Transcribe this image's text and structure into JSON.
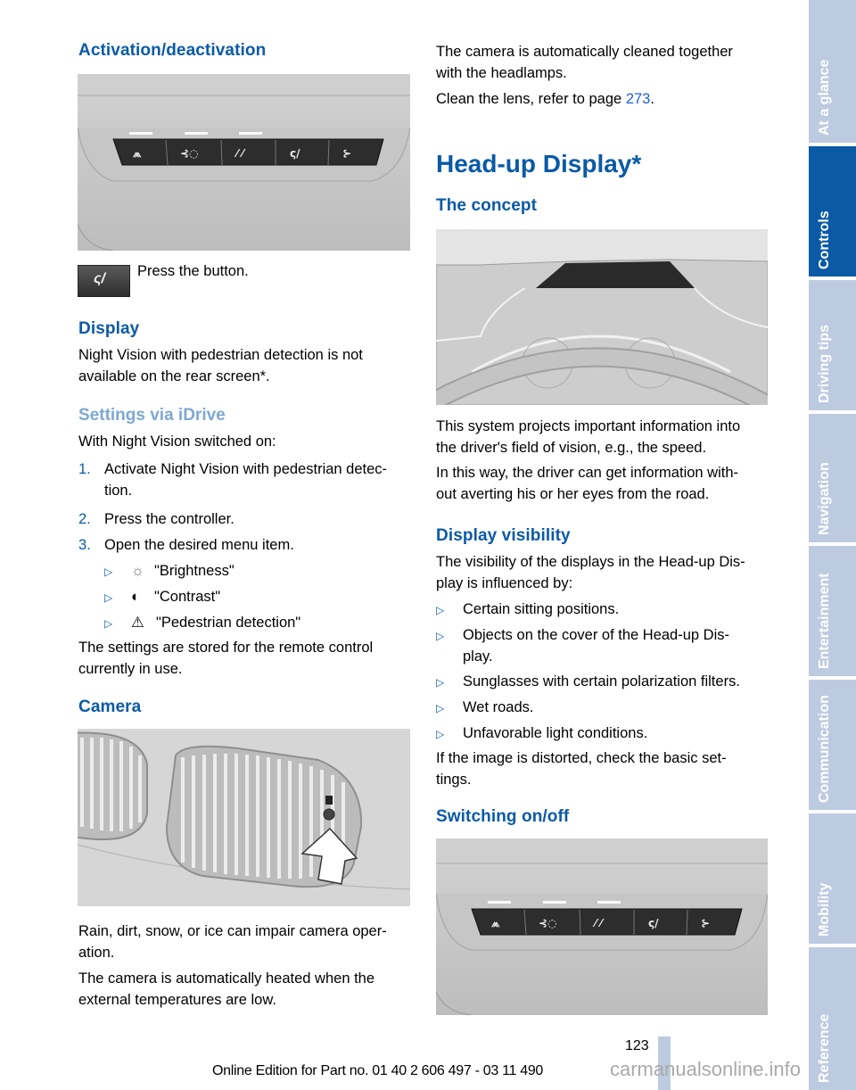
{
  "left_column": {
    "activation_heading": "Activation/deactivation",
    "press_button_text": "Press the button.",
    "display_heading": "Display",
    "display_text_line1": "Night Vision with pedestrian detection is not",
    "display_text_line2": "available on the rear screen*.",
    "settings_heading": "Settings via iDrive",
    "settings_intro": "With Night Vision switched on:",
    "steps": [
      {
        "num": "1.",
        "line1": "Activate Night Vision with pedestrian detec-",
        "line2": "tion."
      },
      {
        "num": "2.",
        "line1": "Press the controller."
      },
      {
        "num": "3.",
        "line1": "Open the desired menu item."
      }
    ],
    "menu_items": [
      {
        "icon": "brightness-icon",
        "glyph": "☼",
        "label": "\"Brightness\""
      },
      {
        "icon": "contrast-icon",
        "glyph": "◐",
        "label": "\"Contrast\""
      },
      {
        "icon": "warning-triangle-icon",
        "glyph": "⚠",
        "label": "\"Pedestrian detection\""
      }
    ],
    "bullet_glyph": "▷",
    "settings_stored_line1": "The settings are stored for the remote control",
    "settings_stored_line2": "currently in use.",
    "camera_heading": "Camera",
    "camera_text1_line1": "Rain, dirt, snow, or ice can impair camera oper-",
    "camera_text1_line2": "ation.",
    "camera_text2_line1": "The camera is automatically heated when the",
    "camera_text2_line2": "external temperatures are low."
  },
  "right_column": {
    "clean_text_line1": "The camera is automatically cleaned together",
    "clean_text_line2": "with the headlamps.",
    "clean_lens_prefix": "Clean the lens, refer to page ",
    "clean_lens_page": "273",
    "clean_lens_suffix": ".",
    "hud_heading": "Head-up Display*",
    "concept_heading": "The concept",
    "concept_text1_line1": "This system projects important information into",
    "concept_text1_line2": "the driver's field of vision, e.g., the speed.",
    "concept_text2_line1": "In this way, the driver can get information with-",
    "concept_text2_line2": "out averting his or her eyes from the road.",
    "visibility_heading": "Display visibility",
    "visibility_intro_line1": "The visibility of the displays in the Head-up Dis-",
    "visibility_intro_line2": "play is influenced by:",
    "visibility_bullets": [
      {
        "line1": "Certain sitting positions."
      },
      {
        "line1": "Objects on the cover of the Head-up Dis-",
        "line2": "play."
      },
      {
        "line1": "Sunglasses with certain polarization filters."
      },
      {
        "line1": "Wet roads."
      },
      {
        "line1": "Unfavorable light conditions."
      }
    ],
    "distorted_line1": "If the image is distorted, check the basic set-",
    "distorted_line2": "tings.",
    "switching_heading": "Switching on/off"
  },
  "side_tabs": [
    {
      "label": "At a glance",
      "active": false
    },
    {
      "label": "Controls",
      "active": true
    },
    {
      "label": "Driving tips",
      "active": false
    },
    {
      "label": "Navigation",
      "active": false
    },
    {
      "label": "Entertainment",
      "active": false
    },
    {
      "label": "Communication",
      "active": false
    },
    {
      "label": "Mobility",
      "active": false
    },
    {
      "label": "Reference",
      "active": false
    }
  ],
  "footer": {
    "page_number": "123",
    "edition_text": "Online Edition for Part no. 01 40 2 606 497 - 03 11 490",
    "watermark": "carmanualsonline.info"
  },
  "colors": {
    "heading_blue": "#0a5aa6",
    "heading_light_blue": "#7fa7d3",
    "tab_inactive": "#bccbe0",
    "tab_active": "#0a5aa6",
    "link_blue": "#1f5fd6"
  }
}
